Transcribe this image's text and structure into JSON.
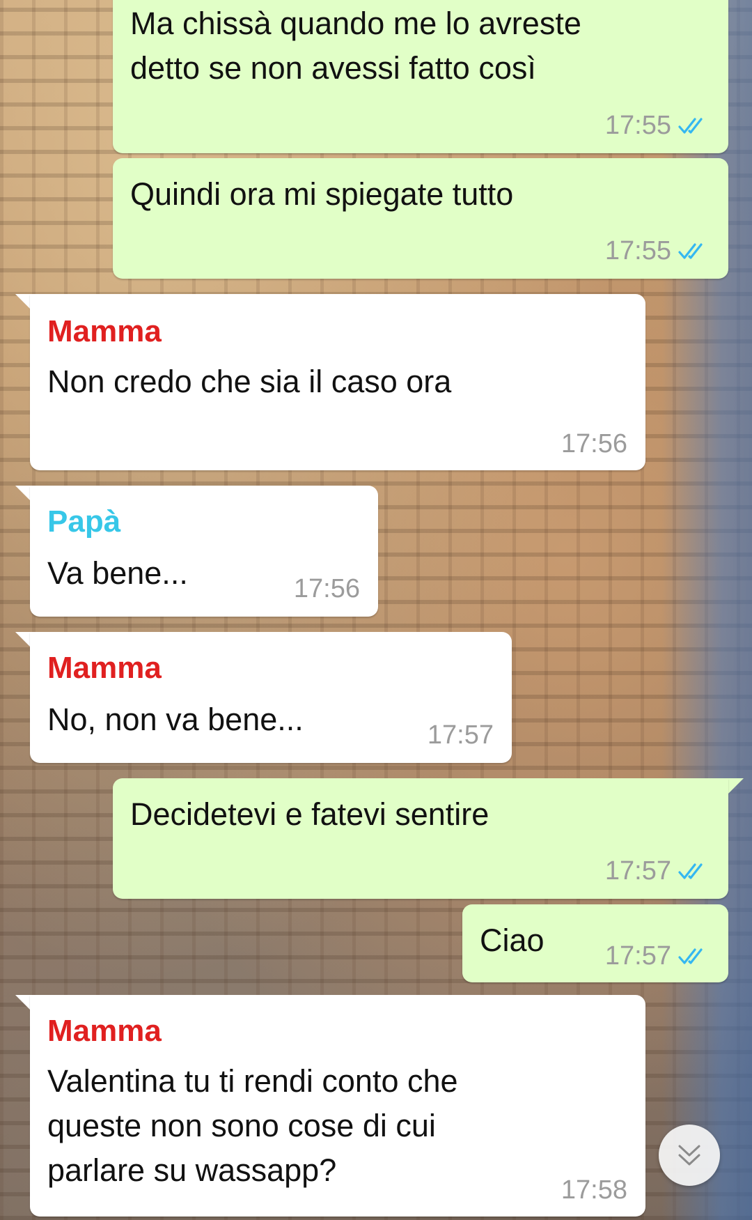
{
  "colors": {
    "outgoing_bubble": "#e1ffc7",
    "incoming_bubble": "#ffffff",
    "sender_mamma": "#e02020",
    "sender_papa": "#37c7e8",
    "timestamp": "#9b9b9b",
    "read_ticks": "#34b7f1"
  },
  "messages": [
    {
      "direction": "out",
      "text": "Ma chissà quando me lo avreste\ndetto se non avessi fatto così",
      "time": "17:55",
      "status": "read-double-tick-icon"
    },
    {
      "direction": "out",
      "text": "Quindi ora mi spiegate tutto",
      "time": "17:55",
      "status": "read-double-tick-icon"
    },
    {
      "direction": "in",
      "sender": "Mamma",
      "text": "Non credo che sia il caso ora",
      "time": "17:56"
    },
    {
      "direction": "in",
      "sender": "Papà",
      "text": "Va bene...",
      "time": "17:56"
    },
    {
      "direction": "in",
      "sender": "Mamma",
      "text": "No, non va bene...",
      "time": "17:57"
    },
    {
      "direction": "out",
      "text": "Decidetevi e fatevi sentire",
      "time": "17:57",
      "status": "read-double-tick-icon"
    },
    {
      "direction": "out",
      "text": "Ciao",
      "time": "17:57",
      "status": "read-double-tick-icon"
    },
    {
      "direction": "in",
      "sender": "Mamma",
      "text": "Valentina tu ti rendi conto che\nqueste non sono cose di cui\nparlare su wassapp?",
      "time": "17:58"
    }
  ],
  "scroll_button": {
    "icon": "double-chevron-down-icon"
  }
}
